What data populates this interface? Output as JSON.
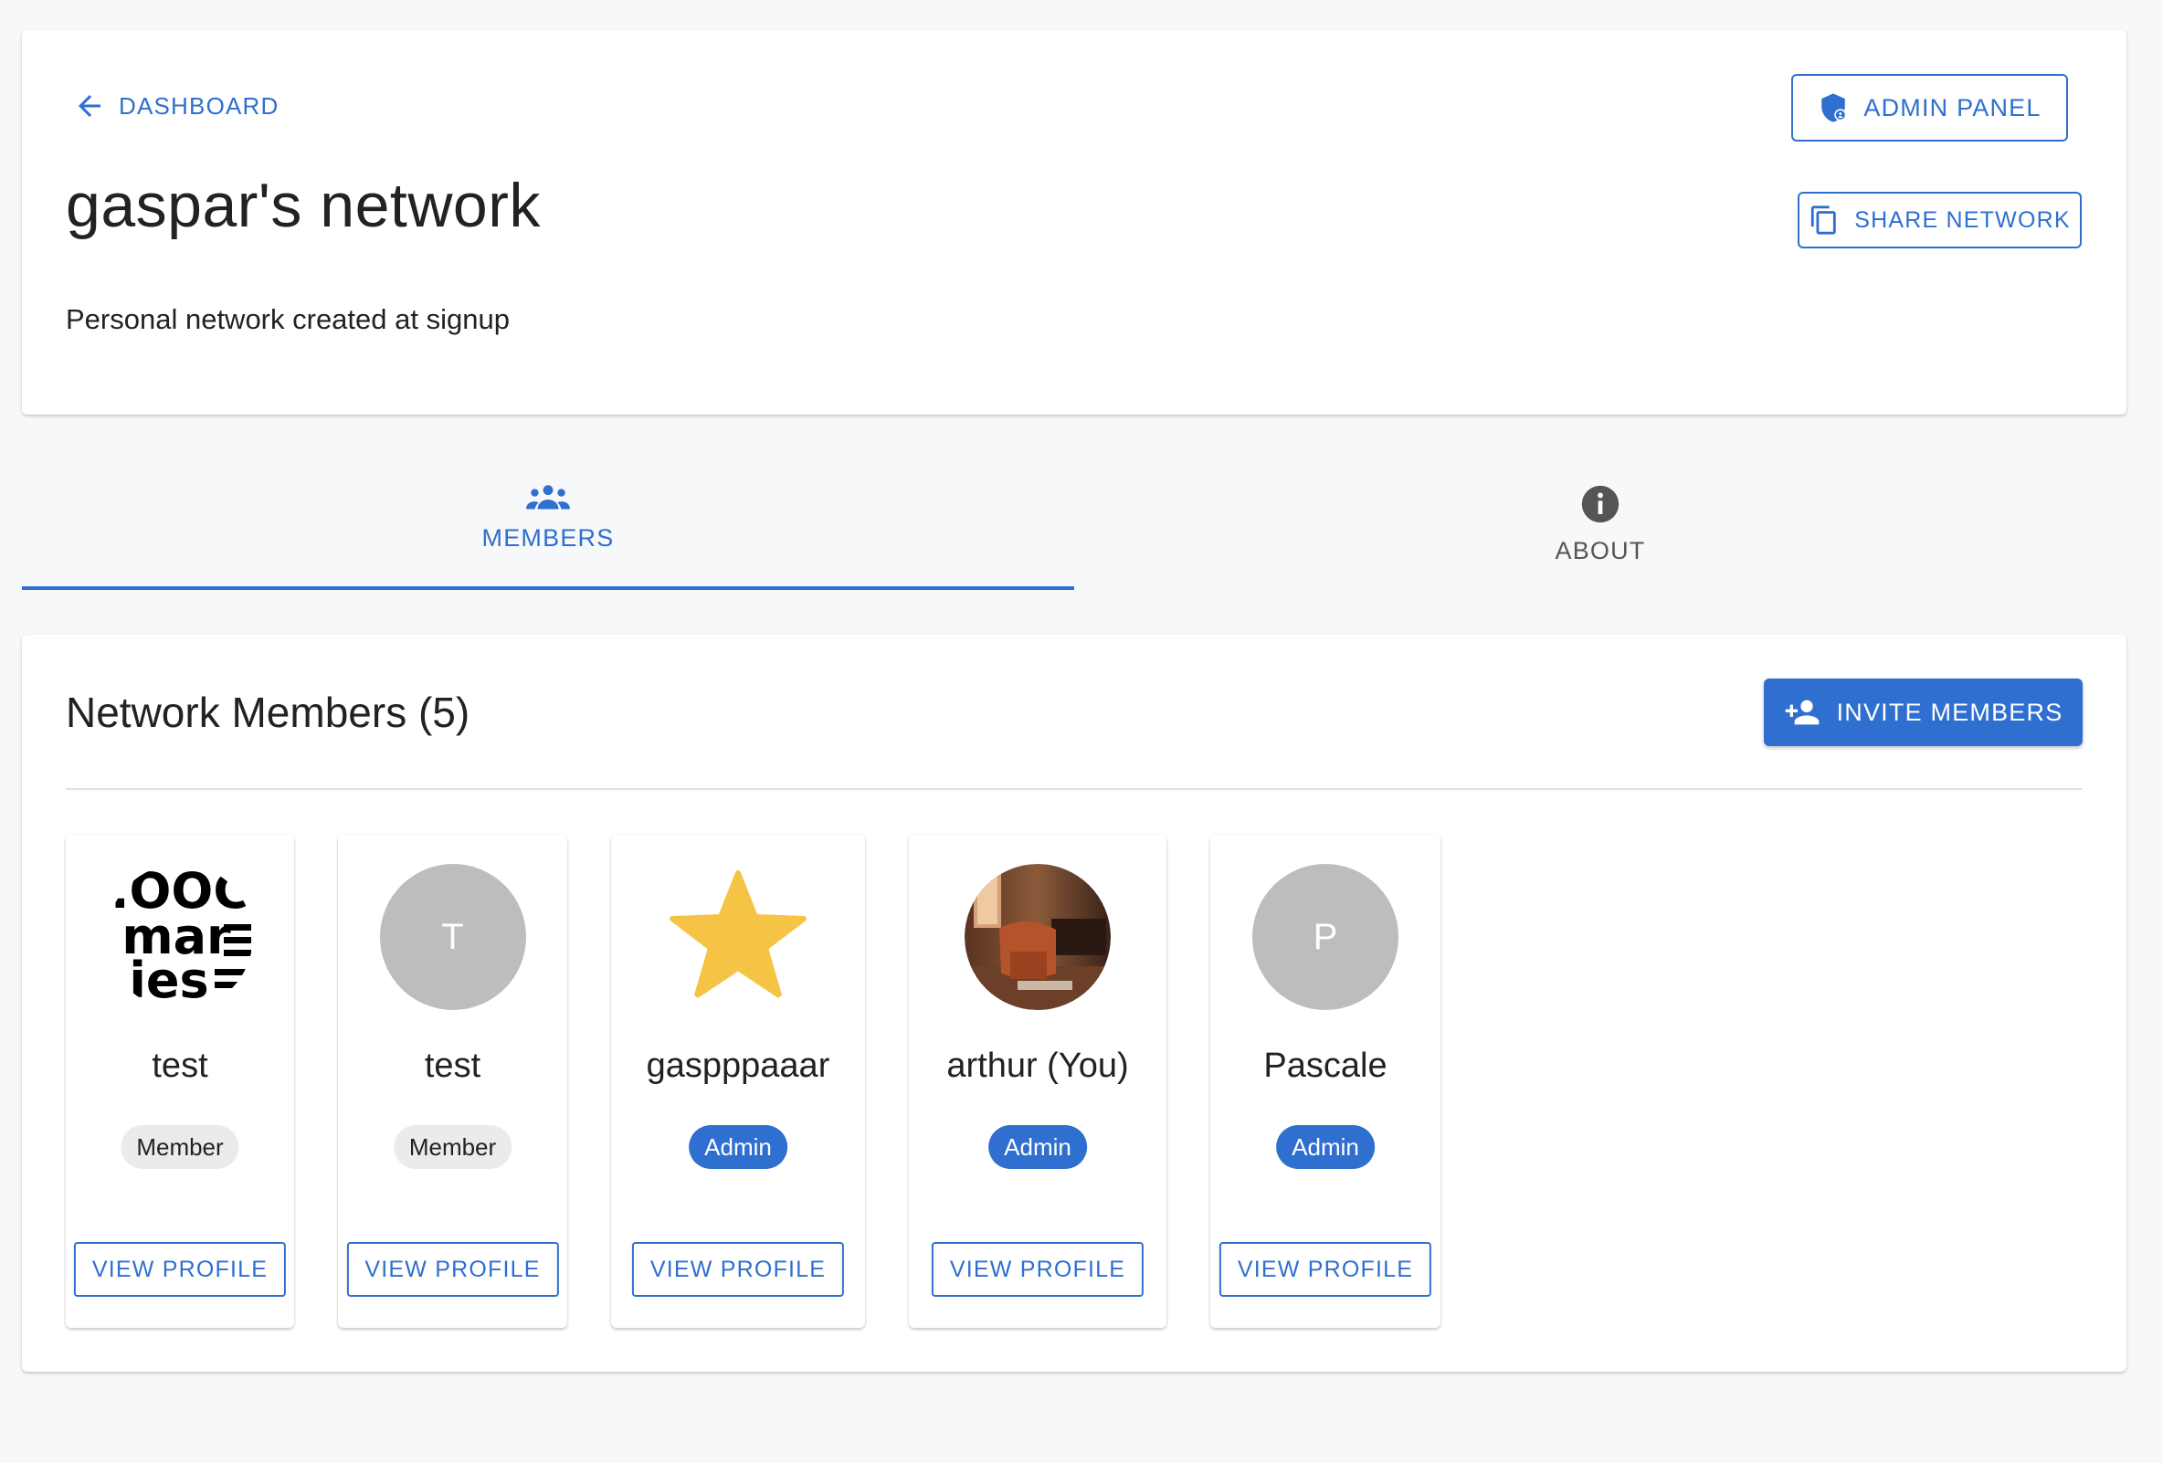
{
  "header": {
    "back_label": "DASHBOARD",
    "title": "gaspar's network",
    "description": "Personal network created at signup",
    "admin_panel_label": "ADMIN PANEL",
    "share_label": "SHARE NETWORK"
  },
  "tabs": [
    {
      "label": "MEMBERS",
      "icon": "group-icon",
      "active": true
    },
    {
      "label": "ABOUT",
      "icon": "info-icon",
      "active": false
    }
  ],
  "members_section": {
    "title": "Network Members (5)",
    "invite_label": "INVITE MEMBERS"
  },
  "members": [
    {
      "name": "test",
      "role": "Member",
      "avatar": "logo-avatar",
      "view_label": "VIEW PROFILE"
    },
    {
      "name": "test",
      "role": "Member",
      "avatar": "T",
      "view_label": "VIEW PROFILE"
    },
    {
      "name": "gaspppaaar",
      "role": "Admin",
      "avatar": "star-avatar",
      "view_label": "VIEW PROFILE"
    },
    {
      "name": "arthur (You)",
      "role": "Admin",
      "avatar": "photo-avatar",
      "view_label": "VIEW PROFILE"
    },
    {
      "name": "Pascale",
      "role": "Admin",
      "avatar": "P",
      "view_label": "VIEW PROFILE"
    }
  ],
  "colors": {
    "accent": "#2f6fcf",
    "background": "#f7f8fa",
    "avatar_gray": "#bdbdbd",
    "star": "#f6c445",
    "chip_gray": "#ebebeb"
  }
}
